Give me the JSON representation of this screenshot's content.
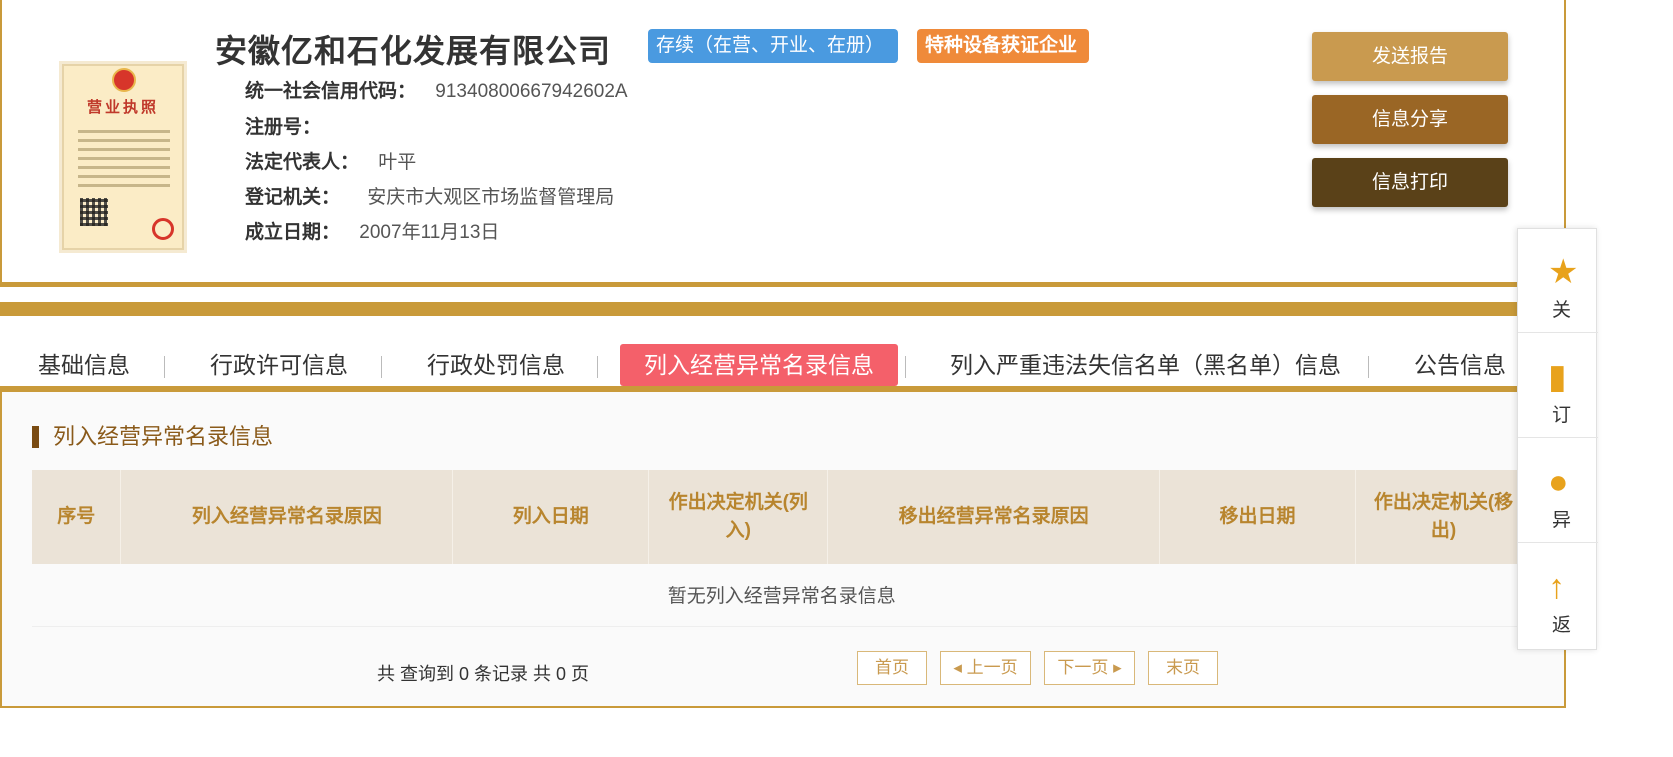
{
  "company": {
    "name": "安徽亿和石化发展有限公司",
    "status_badge": "存续（在营、开业、在册）",
    "special_badge": "特种设备获证企业",
    "license_title": "营业执照",
    "fields": [
      {
        "label": "统一社会信用代码：",
        "value": "91340800667942602A"
      },
      {
        "label": "注册号：",
        "value": ""
      },
      {
        "label": "法定代表人：",
        "value": "叶平"
      },
      {
        "label": "登记机关：",
        "value": "安庆市大观区市场监督管理局"
      },
      {
        "label": "成立日期：",
        "value": "2007年11月13日"
      }
    ]
  },
  "actions": {
    "send_report": "发送报告",
    "share_info": "信息分享",
    "print_info": "信息打印"
  },
  "tabs": [
    {
      "label": "基础信息",
      "active": false
    },
    {
      "label": "行政许可信息",
      "active": false
    },
    {
      "label": "行政处罚信息",
      "active": false
    },
    {
      "label": "列入经营异常名录信息",
      "active": true
    },
    {
      "label": "列入严重违法失信名单（黑名单）信息",
      "active": false
    },
    {
      "label": "公告信息",
      "active": false
    }
  ],
  "section": {
    "title": "列入经营异常名录信息",
    "columns": [
      "序号",
      "列入经营异常名录原因",
      "列入日期",
      "作出决定机关(列入)",
      "移出经营异常名录原因",
      "移出日期",
      "作出决定机关(移出)"
    ],
    "empty_text": "暂无列入经营异常名录信息"
  },
  "pagination": {
    "summary": "共 查询到 0 条记录 共 0 页",
    "first": "首页",
    "prev": "上一页",
    "next": "下一页",
    "last": "末页"
  },
  "float_bar": [
    {
      "icon": "star-icon",
      "label": "关"
    },
    {
      "icon": "bookmark-icon",
      "label": "订"
    },
    {
      "icon": "chat-icon",
      "label": "异"
    },
    {
      "icon": "back-top-icon",
      "label": "返"
    }
  ],
  "colors": {
    "gold": "#c99a3a",
    "active_tab": "#f4606a",
    "status_badge": "#4a9ae0",
    "special_badge": "#ef8a3a",
    "header_text": "#b8852e"
  }
}
